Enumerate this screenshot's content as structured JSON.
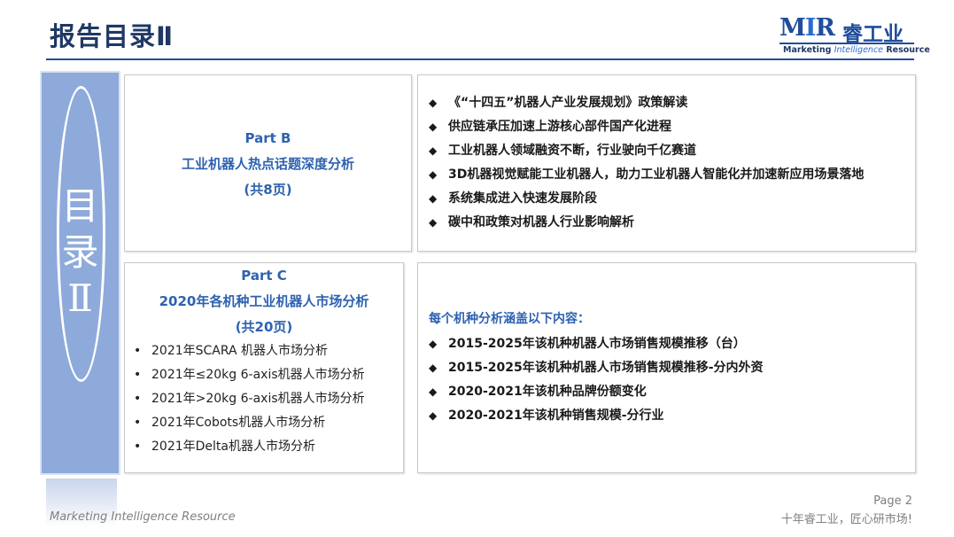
{
  "header": {
    "title": "报告目录Ⅱ"
  },
  "logo": {
    "brand": "MIR",
    "brand_m": "M",
    "brand_i": "I",
    "brand_r": "R",
    "cn": "睿工业",
    "sub_1": "Marketing ",
    "sub_2": "Intelligence",
    "sub_3": " Resource"
  },
  "sidebar": {
    "text_line1": "目",
    "text_line2": "录",
    "text_line3": "Ⅱ"
  },
  "part_b": {
    "label": "Part B",
    "title": "工业机器人热点话题深度分析",
    "pages": "(共8页)"
  },
  "topics": [
    "《“十四五”机器人产业发展规划》政策解读",
    "供应链承压加速上游核心部件国产化进程",
    "工业机器人领域融资不断，行业驶向千亿赛道",
    "3D机器视觉赋能工业机器人，助力工业机器人智能化并加速新应用场景落地",
    "系统集成进入快速发展阶段",
    "碳中和政策对机器人行业影响解析"
  ],
  "part_c": {
    "label": "Part C",
    "title": "2020年各机种工业机器人市场分析",
    "pages": "(共20页)"
  },
  "part_c_items": [
    "2021年SCARA 机器人市场分析",
    "2021年≤20kg 6-axis机器人市场分析",
    "2021年>20kg 6-axis机器人市场分析",
    "2021年Cobots机器人市场分析",
    "2021年Delta机器人市场分析"
  ],
  "coverage": {
    "heading": "每个机种分析涵盖以下内容：",
    "items": [
      "2015-2025年该机种机器人市场销售规模推移（台）",
      "2015-2025年该机种机器人市场销售规模推移-分内外资",
      "2020-2021年该机种品牌份额变化",
      "2020-2021年该机种销售规模-分行业"
    ]
  },
  "footer": {
    "left": "Marketing Intelligence Resource",
    "page": "Page 2",
    "slogan": "十年睿工业，匠心研市场!"
  },
  "colors": {
    "primary": "#1f3864",
    "accent": "#2e62b0",
    "sidebar": "#8eaadb"
  }
}
